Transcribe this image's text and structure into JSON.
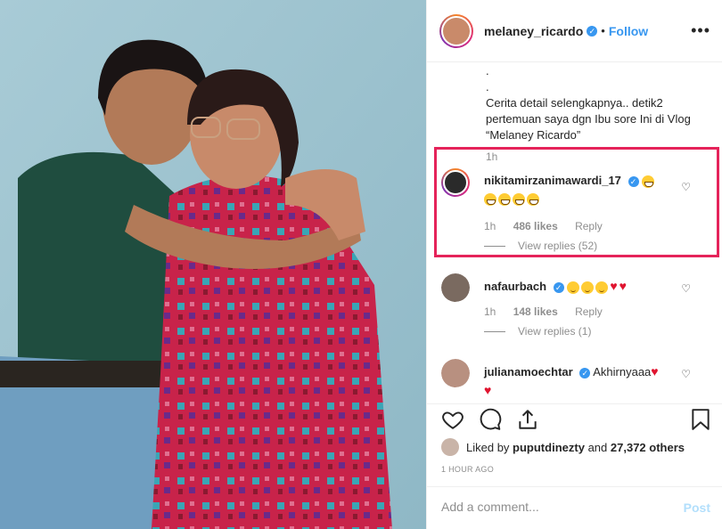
{
  "header": {
    "username": "melaney_ricardo",
    "separator": "•",
    "follow_label": "Follow",
    "more_label": "•••"
  },
  "caption": {
    "dot1": ".",
    "dot2": ".",
    "text": "Cerita detail selengkapnya.. detik2 pertemuan saya dgn Ibu sore Ini di Vlog “Melaney Ricardo”",
    "time": "1h"
  },
  "comments": [
    {
      "username": "nikitamirzanimawardi_17",
      "time": "1h",
      "likes": "486 likes",
      "reply_label": "Reply",
      "view_replies": "View replies (52)"
    },
    {
      "username": "nafaurbach",
      "time": "1h",
      "likes": "148 likes",
      "reply_label": "Reply",
      "view_replies": "View replies (1)"
    },
    {
      "username": "julianamoechtar",
      "text": "Akhirnyaaa"
    }
  ],
  "likes": {
    "prefix": "Liked by",
    "user": "puputdinezty",
    "and": "and",
    "others": "27,372 others"
  },
  "post_time": "1 HOUR AGO",
  "add_comment": {
    "placeholder": "Add a comment...",
    "post_label": "Post"
  },
  "colors": {
    "accent": "#3897f0",
    "highlight": "#e5235a",
    "heart": "#e0142f"
  },
  "icons": [
    "verified-badge-icon",
    "heart-icon",
    "comment-icon",
    "share-icon",
    "bookmark-icon",
    "more-icon"
  ]
}
